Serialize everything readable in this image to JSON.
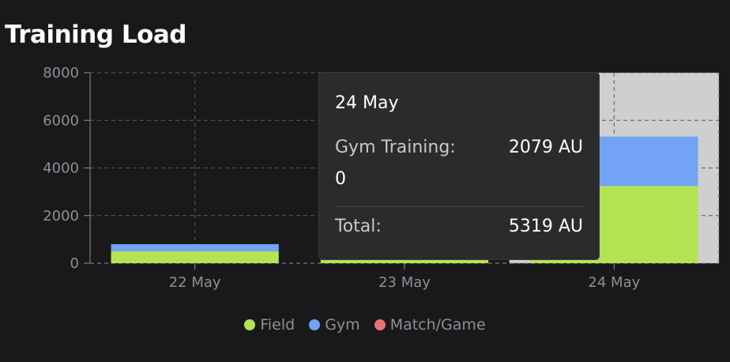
{
  "header": {
    "title": "Training Load"
  },
  "colors": {
    "field": "#b4e354",
    "gym": "#72a3f5",
    "match": "#e57373",
    "highlight": "#cfcfcf",
    "grid": "#5a5a5e"
  },
  "chart_data": {
    "type": "bar",
    "stacked": true,
    "categories": [
      "22 May",
      "23 May",
      "24 May"
    ],
    "series": [
      {
        "name": "Field",
        "values": [
          500,
          150,
          3240
        ],
        "color": "#b4e354"
      },
      {
        "name": "Gym",
        "values": [
          300,
          0,
          2079
        ],
        "color": "#72a3f5"
      },
      {
        "name": "Match/Game",
        "values": [
          0,
          0,
          0
        ],
        "color": "#e57373"
      }
    ],
    "yticks": [
      "0",
      "2000",
      "4000",
      "6000",
      "8000"
    ],
    "ylim": [
      0,
      8000
    ],
    "highlighted_category": "24 May",
    "grid": true,
    "legend_position": "bottom"
  },
  "tooltip": {
    "date": "24 May",
    "label": "Gym Training:",
    "value": "2079 AU",
    "extra": "0",
    "total_label": "Total:",
    "total_value": "5319 AU"
  },
  "legend": {
    "items": [
      {
        "label": "Field",
        "color": "#b4e354"
      },
      {
        "label": "Gym",
        "color": "#72a3f5"
      },
      {
        "label": "Match/Game",
        "color": "#e57373"
      }
    ]
  }
}
